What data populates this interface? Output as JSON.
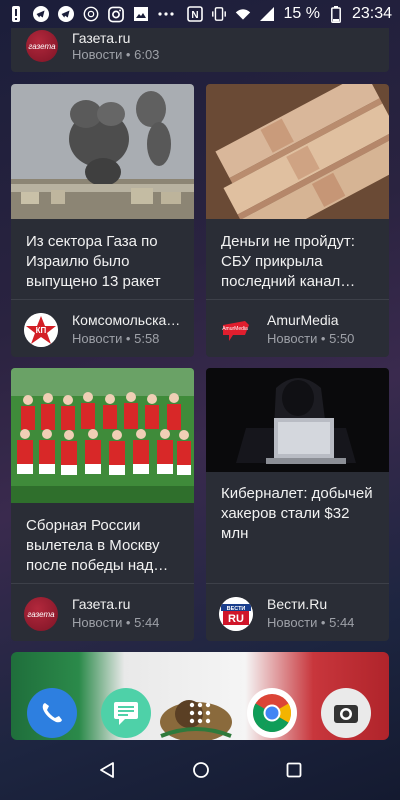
{
  "status_bar": {
    "battery_percent": "15 %",
    "time": "23:34",
    "icons_left": [
      "alert-icon",
      "telegram-icon",
      "telegram-icon",
      "whatsapp-icon",
      "instagram-icon",
      "gallery-icon",
      "more-dots-icon"
    ],
    "icons_right": [
      "nfc-icon",
      "vibrate-icon",
      "wifi-icon",
      "signal-icon"
    ]
  },
  "top_card": {
    "source": "Газета.ru",
    "meta": "Новости • 6:03"
  },
  "cards": [
    {
      "headline": "Из сектора Газа по Израилю было выпущено 13 ракет",
      "source": "Комсомольска…",
      "meta": "Новости • 5:58",
      "logo_text": "КП"
    },
    {
      "headline": "Деньги не пройдут: СБУ прикрыла последний канал…",
      "source": "AmurMedia",
      "meta": "Новости • 5:50",
      "logo_text": "AmurMedia"
    },
    {
      "headline": "Сборная России вылетела в Москву после победы над…",
      "source": "Газета.ru",
      "meta": "Новости • 5:44",
      "logo_text": "газета"
    },
    {
      "headline": "Киберналет: добычей хакеров стали $32 млн",
      "source": "Вести.Ru",
      "meta": "Новости • 5:44",
      "logo_text_top": "ВЕСТИ",
      "logo_text_bottom": "RU"
    }
  ],
  "dock": {
    "apps": [
      "phone-icon",
      "messages-icon",
      "app-drawer-icon",
      "chrome-icon",
      "camera-icon"
    ]
  },
  "colors": {
    "card_bg": "#2a2d36",
    "meta_text": "#9ea1a8"
  }
}
